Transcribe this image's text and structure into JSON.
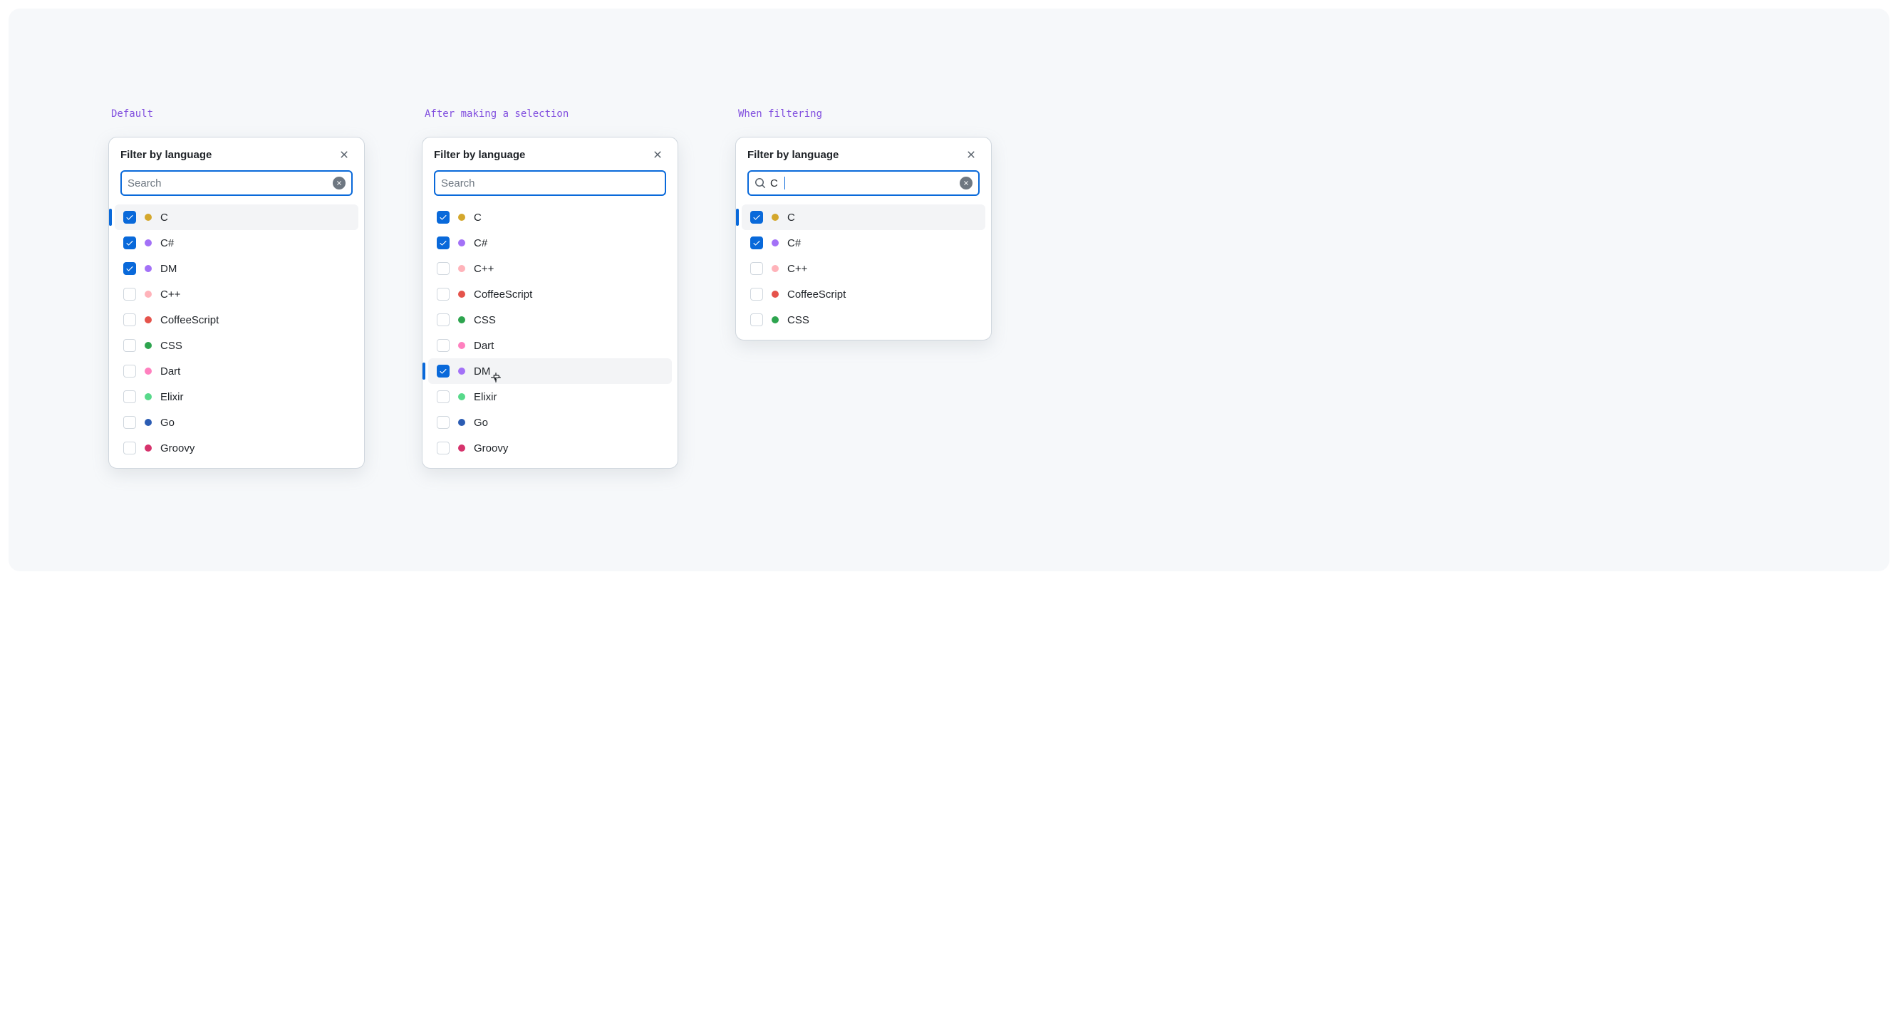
{
  "panels": [
    {
      "caption": "Default",
      "title": "Filter by language",
      "search": {
        "placeholder": "Search",
        "value": "",
        "show_search_icon": false,
        "show_clear": true
      },
      "items": [
        {
          "label": "C",
          "color": "#d4a72c",
          "checked": true,
          "highlight": true
        },
        {
          "label": "C#",
          "color": "#a371f7",
          "checked": true,
          "highlight": false
        },
        {
          "label": "DM",
          "color": "#a371f7",
          "checked": true,
          "highlight": false
        },
        {
          "label": "C++",
          "color": "#ffb3ba",
          "checked": false,
          "highlight": false
        },
        {
          "label": "CoffeeScript",
          "color": "#e5534b",
          "checked": false,
          "highlight": false
        },
        {
          "label": "CSS",
          "color": "#2da44e",
          "checked": false,
          "highlight": false
        },
        {
          "label": "Dart",
          "color": "#ff80bf",
          "checked": false,
          "highlight": false
        },
        {
          "label": "Elixir",
          "color": "#57d98a",
          "checked": false,
          "highlight": false
        },
        {
          "label": "Go",
          "color": "#2b5cb3",
          "checked": false,
          "highlight": false
        },
        {
          "label": "Groovy",
          "color": "#d6336c",
          "checked": false,
          "highlight": false
        }
      ]
    },
    {
      "caption": "After making a selection",
      "title": "Filter by language",
      "search": {
        "placeholder": "Search",
        "value": "",
        "show_search_icon": false,
        "show_clear": false
      },
      "hover_cursor_index": 6,
      "items": [
        {
          "label": "C",
          "color": "#d4a72c",
          "checked": true,
          "highlight": false
        },
        {
          "label": "C#",
          "color": "#a371f7",
          "checked": true,
          "highlight": false
        },
        {
          "label": "C++",
          "color": "#ffb3ba",
          "checked": false,
          "highlight": false
        },
        {
          "label": "CoffeeScript",
          "color": "#e5534b",
          "checked": false,
          "highlight": false
        },
        {
          "label": "CSS",
          "color": "#2da44e",
          "checked": false,
          "highlight": false
        },
        {
          "label": "Dart",
          "color": "#ff80bf",
          "checked": false,
          "highlight": false
        },
        {
          "label": "DM",
          "color": "#a371f7",
          "checked": true,
          "highlight": true,
          "cursor": true
        },
        {
          "label": "Elixir",
          "color": "#57d98a",
          "checked": false,
          "highlight": false
        },
        {
          "label": "Go",
          "color": "#2b5cb3",
          "checked": false,
          "highlight": false
        },
        {
          "label": "Groovy",
          "color": "#d6336c",
          "checked": false,
          "highlight": false
        }
      ]
    },
    {
      "caption": "When filtering",
      "title": "Filter by language",
      "search": {
        "placeholder": "Search",
        "value": "C",
        "show_search_icon": true,
        "show_clear": true
      },
      "items": [
        {
          "label": "C",
          "color": "#d4a72c",
          "checked": true,
          "highlight": true
        },
        {
          "label": "C#",
          "color": "#a371f7",
          "checked": true,
          "highlight": false
        },
        {
          "label": "C++",
          "color": "#ffb3ba",
          "checked": false,
          "highlight": false
        },
        {
          "label": "CoffeeScript",
          "color": "#e5534b",
          "checked": false,
          "highlight": false
        },
        {
          "label": "CSS",
          "color": "#2da44e",
          "checked": false,
          "highlight": false
        }
      ]
    }
  ]
}
